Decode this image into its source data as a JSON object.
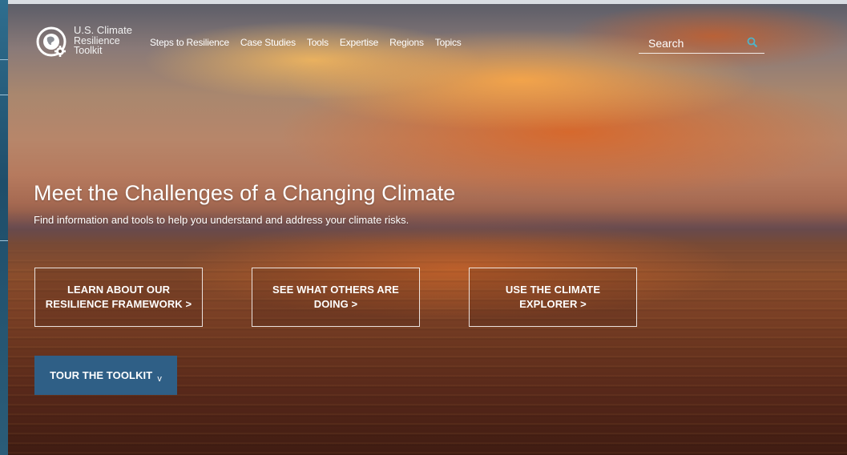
{
  "site": {
    "logo_lines": [
      "U.S. Climate",
      "Resilience",
      "Toolkit"
    ]
  },
  "nav": {
    "items": [
      "Steps to Resilience",
      "Case Studies",
      "Tools",
      "Expertise",
      "Regions",
      "Topics"
    ]
  },
  "search": {
    "placeholder": "Search"
  },
  "hero": {
    "title": "Meet the Challenges of a Changing Climate",
    "subtitle": "Find information and tools to help you understand and address your climate risks."
  },
  "cta": {
    "framework": [
      "LEARN ABOUT OUR",
      "RESILIENCE FRAMEWORK >"
    ],
    "others": [
      "SEE WHAT OTHERS ARE",
      "DOING >"
    ],
    "explorer": [
      "USE THE CLIMATE",
      "EXPLORER >"
    ]
  },
  "tour": {
    "label": "TOUR THE TOOLKIT",
    "chevron": "v"
  },
  "colors": {
    "tour_button": "#2f5f86",
    "search_icon": "#4fb3c8"
  },
  "icons": [
    "logo-globe-gear-icon",
    "search-icon",
    "chevron-down-icon"
  ]
}
